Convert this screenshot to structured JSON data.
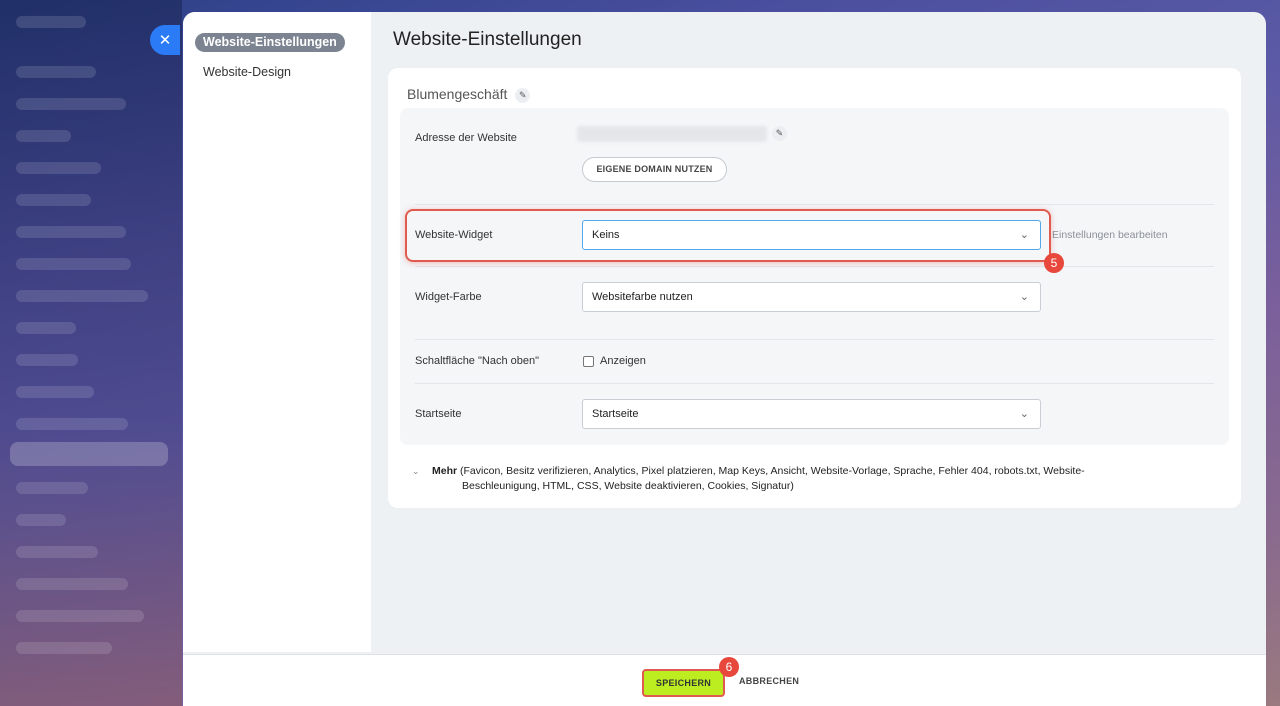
{
  "nav": {
    "items": [
      {
        "label": "Website-Einstellungen",
        "active": true
      },
      {
        "label": "Website-Design",
        "active": false
      }
    ]
  },
  "page_title": "Website-Einstellungen",
  "site": {
    "name": "Blumengeschäft"
  },
  "form": {
    "address_label": "Adresse der Website",
    "own_domain_button": "EIGENE DOMAIN NUTZEN",
    "widget_label": "Website-Widget",
    "widget_value": "Keins",
    "widget_edit_link": "Einstellungen bearbeiten",
    "widget_color_label": "Widget-Farbe",
    "widget_color_value": "Websitefarbe nutzen",
    "scroll_button_label": "Schaltfläche \"Nach oben\"",
    "scroll_button_checkbox": "Anzeigen",
    "homepage_label": "Startseite",
    "homepage_value": "Startseite"
  },
  "more": {
    "head": "Mehr",
    "line1": "(Favicon,  Besitz verifizieren,  Analytics,  Pixel platzieren,  Map Keys,  Ansicht,  Website-Vorlage,  Sprache,  Fehler 404,  robots.txt,  Website-",
    "line2": "Beschleunigung,  HTML,  CSS,  Website deaktivieren,  Cookies,  Signatur)"
  },
  "footer": {
    "save_label": "SPEICHERN",
    "cancel_label": "ABBRECHEN"
  },
  "annotations": {
    "step5": "5",
    "step6": "6"
  },
  "colors": {
    "save_button": "#bbed21",
    "highlight": "#e05a4f",
    "close_button": "#2b7bf6"
  }
}
